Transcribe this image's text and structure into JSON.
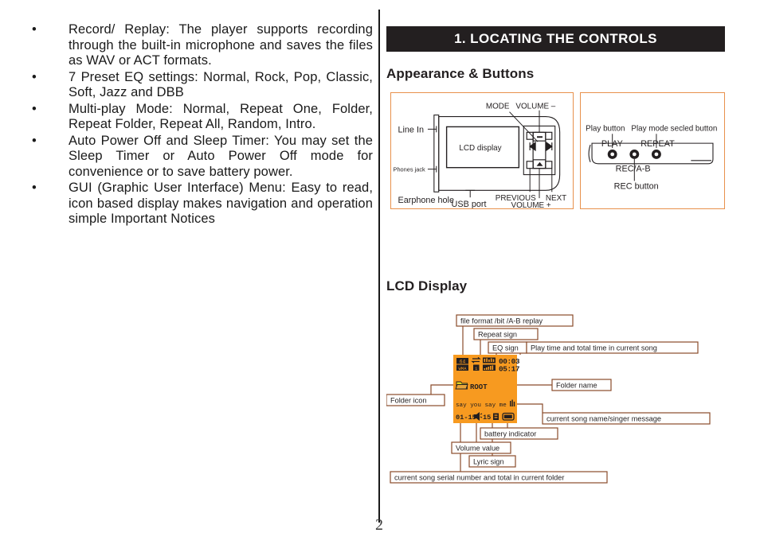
{
  "left_column": {
    "bullets": [
      "Record/ Replay: The player supports recording through the built-in microphone and saves the files as WAV or ACT formats.",
      "7 Preset EQ settings: Normal, Rock, Pop, Classic, Soft, Jazz and DBB",
      "Multi-play Mode: Normal, Repeat One, Folder, Repeat Folder, Repeat All, Random, Intro.",
      "Auto Power Off and Sleep Timer: You may set the Sleep Timer or Auto Power Off mode for convenience or to save battery power.",
      "GUI (Graphic User Interface) Menu: Easy to read, icon based display makes navigation and operation simple Important Notices"
    ],
    "bullet_glyph": "•"
  },
  "right_column": {
    "section_title": "1. LOCATING THE CONTROLS",
    "heading_appearance": "Appearance & Buttons",
    "heading_lcd": "LCD Display"
  },
  "diagram_front": {
    "labels": {
      "line_in": "Line In",
      "phones_jack": "Phones jack",
      "earphone_hole": "Earphone hole",
      "usb_port": "USB port",
      "lcd_display": "LCD display",
      "mode": "MODE",
      "volume_minus": "VOLUME –",
      "previous": "PREVIOUS",
      "next": "NEXT",
      "volume_plus": "VOLUME +"
    }
  },
  "diagram_side": {
    "labels": {
      "play_button": "Play button",
      "play_mode_selected_button": "Play mode secled button",
      "rec_button": "REC button",
      "play": "PLAY",
      "repeat": "REPEAT",
      "rec_a_b": "REC/A-B"
    }
  },
  "lcd_diagram": {
    "callouts": {
      "file_format": "file format /bit /A-B replay",
      "repeat_sign": "Repeat sign",
      "eq_sign": "EQ sign",
      "play_time": "Play time and total time in current song",
      "folder_name": "Folder name",
      "folder_icon": "Folder icon",
      "song_name": "current song name/singer message",
      "battery_indicator": "battery  indicator",
      "lyric_sign": "Lyric sign",
      "volume_value": "Volume value",
      "serial_number": "current song serial number and total in current folder"
    },
    "screen": {
      "bitrate": "64",
      "format": "WMA",
      "repeat_num": "1",
      "time_elapsed": "00:03",
      "time_total": "05:17",
      "folder": "ROOT",
      "song_title": "say you  say me .",
      "track_index": "01-15",
      "volume": "15"
    },
    "colors": {
      "lcd_background": "#f79a20",
      "lcd_ink": "#231f20",
      "callout_border": "#8a4b2a",
      "accent_orange": "#e8914c"
    }
  },
  "footer": {
    "page_number": "2"
  }
}
